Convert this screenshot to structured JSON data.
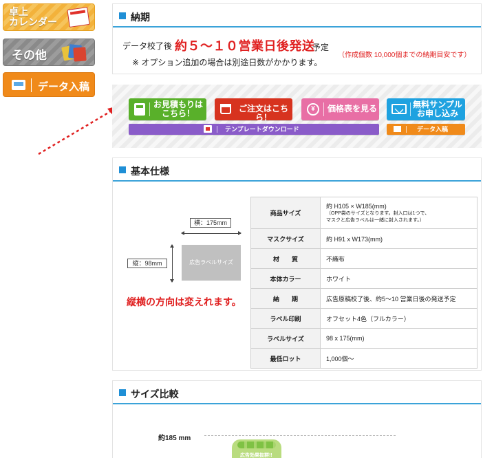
{
  "sidebar": {
    "calendar_label": "卓上\nカレンダー",
    "other_label": "その他",
    "data_label": "データ入稿"
  },
  "nouki": {
    "title": "納期",
    "prefix": "データ校了後",
    "highlight": "約５～１０営業日後発送",
    "suffix": "予定",
    "note_red": "（作成個数 10,000個までの納期目安です）",
    "note": "※ オプション追加の場合は別途日数がかかります。"
  },
  "buttons": {
    "estimate": "お見積もりは\nこちら！",
    "order": "ご注文はこちら！",
    "price_icon": "¥",
    "price": "価格表を見る",
    "sample": "無料サンプル\nお申し込み",
    "template": "テンプレートダウンロード",
    "data": "データ入稿"
  },
  "kihon": {
    "title": "基本仕様",
    "width_label": "横：175mm",
    "height_label": "縦：98mm",
    "label_box": "広告ラベルサイズ",
    "orientation_note": "縦横の方向は変えれます。",
    "specs": [
      {
        "key": "商品サイズ",
        "value": "約 H105 × W185(mm)",
        "sub": "（OPP袋のサイズとなります。封入口は1つで、\nマスクと広告ラベルは一緒に封入されます。）"
      },
      {
        "key": "マスクサイズ",
        "value": "約 H91 x W173(mm)"
      },
      {
        "key": "材　　質",
        "value": "不織布"
      },
      {
        "key": "本体カラー",
        "value": "ホワイト"
      },
      {
        "key": "納　　期",
        "value": "広告原稿校了後、約5～10 営業日後の発送予定"
      },
      {
        "key": "ラベル印刷",
        "value": "オフセット4色（フルカラー）"
      },
      {
        "key": "ラベルサイズ",
        "value": "98 x 175(mm)"
      },
      {
        "key": "最低ロット",
        "value": "1,000個～"
      }
    ]
  },
  "size_compare": {
    "title": "サイズ比較",
    "length_label": "約185 mm",
    "mask_text": "広告効果抜群!!"
  },
  "colors": {
    "accent_blue": "#1f8fd6",
    "red": "#e02020",
    "green": "#59b02a",
    "order_red": "#d7331f",
    "pink": "#e86fa5",
    "sky": "#1fa2e0",
    "purple": "#8a5cc9",
    "orange": "#f08a1a"
  }
}
